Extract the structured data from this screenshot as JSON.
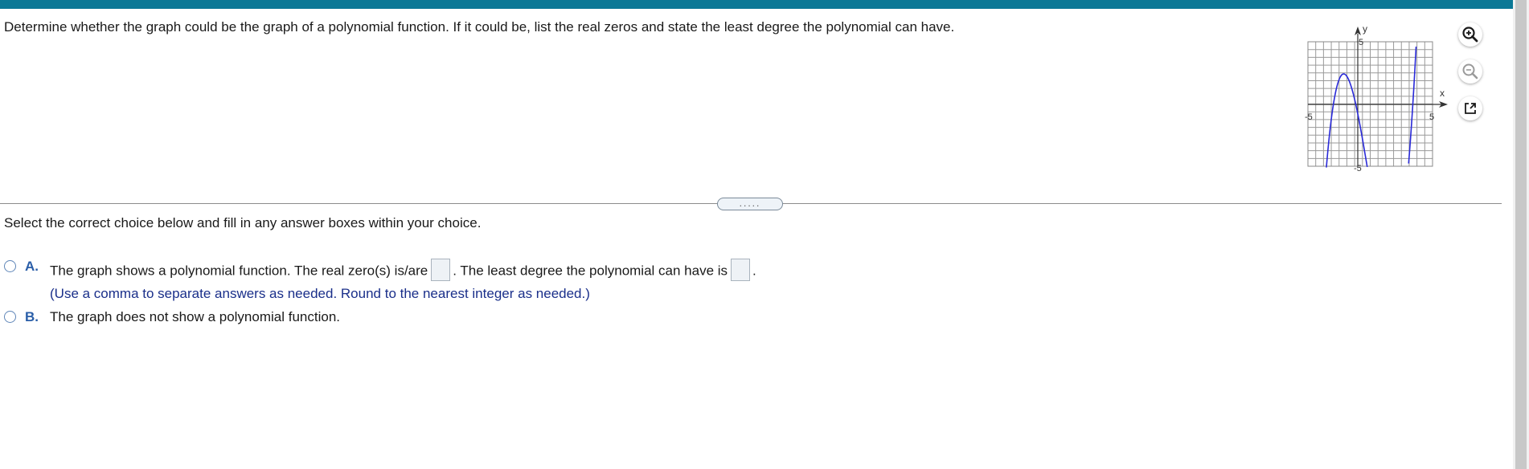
{
  "question": {
    "text": "Determine whether the graph could be the graph of a polynomial function. If it could be, list the real zeros and state the least degree the polynomial can have."
  },
  "graph": {
    "axis_x_label": "x",
    "axis_y_label": "y",
    "tick_neg5": "-5",
    "tick_pos5": "5",
    "x_range": [
      -5,
      5
    ],
    "y_range": [
      -5,
      5
    ],
    "curve_color": "#2a2ad8",
    "grid_color": "#9a9a9a"
  },
  "tools": {
    "zoom_in_icon": "zoom-in-icon",
    "zoom_out_icon": "zoom-out-icon",
    "popout_icon": "popout-icon"
  },
  "splitter": {
    "label": "....."
  },
  "instruction": "Select the correct choice below and fill in any answer boxes within your choice.",
  "choices": [
    {
      "letter": "A.",
      "text_before": "The graph shows a polynomial function. The real zero(s) is/are",
      "text_middle": ". The least degree the polynomial can have is",
      "text_after": ".",
      "hint": "(Use a comma to separate answers as needed.  Round to the nearest integer as needed.)",
      "zeros_value": "",
      "degree_value": ""
    },
    {
      "letter": "B.",
      "text": "The graph does not show a polynomial function."
    }
  ],
  "colors": {
    "top_bar": "#0b7896",
    "choice_letter": "#2a5ea8",
    "hint_text": "#1a2f8a"
  }
}
